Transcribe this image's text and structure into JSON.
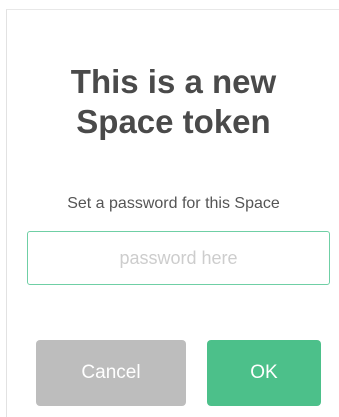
{
  "dialog": {
    "title_line1": "This is a new",
    "title_line2": "Space token",
    "subtitle": "Set a password for this Space",
    "password_input": {
      "placeholder": "password here",
      "value": ""
    },
    "cancel_label": "Cancel",
    "ok_label": "OK"
  },
  "colors": {
    "title_text": "#4a4a4a",
    "input_border": "#6fcfa5",
    "cancel_button": "#bdbdbd",
    "ok_button": "#4cc08a"
  }
}
